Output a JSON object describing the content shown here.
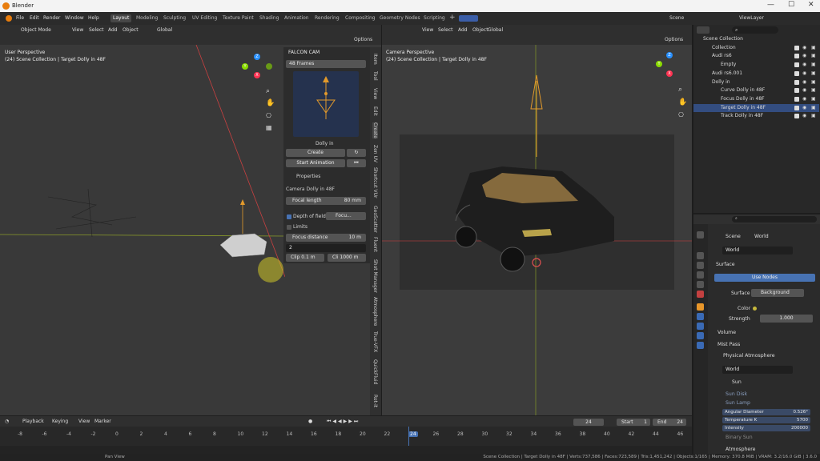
{
  "window": {
    "title": "Blender",
    "minimize": "—",
    "maximize": "☐",
    "close": "✕"
  },
  "menus": [
    "File",
    "Edit",
    "Render",
    "Window",
    "Help"
  ],
  "workspaces": [
    "Layout",
    "Modeling",
    "Sculpting",
    "UV Editing",
    "Texture Paint",
    "Shading",
    "Animation",
    "Rendering",
    "Compositing",
    "Geometry Nodes",
    "Scripting"
  ],
  "active_workspace": "Layout",
  "scene_name": "Scene",
  "view_layer": "ViewLayer",
  "left_viewport": {
    "mode": "Object Mode",
    "menu": [
      "View",
      "Select",
      "Add",
      "Object"
    ],
    "transform": "Global",
    "options": "Options",
    "title": "User Perspective",
    "subtitle": "(24) Scene Collection | Target Dolly in 48F"
  },
  "falcon": {
    "header": "FALCON CAM",
    "frames": "48 Frames",
    "preview_label": "Dolly in",
    "create": "Create",
    "start_animation": "Start Animation",
    "properties": "Properties",
    "camera_name": "Camera Dolly in 48F",
    "focal_length_label": "Focal length",
    "focal_length_value": "80 mm",
    "dof_label": "Depth of field",
    "dof_value": "Focu...",
    "limits": "Limits",
    "focus_distance_label": "Focus distance",
    "focus_distance_value": "10 m",
    "input_value": "2",
    "clip_start": "Clip 0.1 m",
    "clip_end": "Cli 1000 m"
  },
  "vertical_tabs": [
    "Item",
    "Tool",
    "View",
    "Edit",
    "Create",
    "Zen UV",
    "Shortcut VUr",
    "GeoScatter",
    "Fluent",
    "Shot Manager",
    "Atmosphere",
    "True-VFX",
    "QuickFluid",
    "Rot-it"
  ],
  "right_viewport": {
    "menu": [
      "View",
      "Select",
      "Add",
      "Object"
    ],
    "transform": "Global",
    "options": "Options",
    "title": "Camera Perspective",
    "subtitle": "(24) Scene Collection | Target Dolly in 48F"
  },
  "outliner": {
    "search_placeholder": "",
    "rows": [
      {
        "label": "Scene Collection",
        "indent": 0,
        "selected": false
      },
      {
        "label": "Collection",
        "indent": 1,
        "selected": false
      },
      {
        "label": "Audi rs6",
        "indent": 1,
        "selected": false
      },
      {
        "label": "Empty",
        "indent": 2,
        "selected": false
      },
      {
        "label": "Audi rs6.001",
        "indent": 1,
        "selected": false
      },
      {
        "label": "Dolly in",
        "indent": 1,
        "selected": false
      },
      {
        "label": "Curve Dolly in 48F",
        "indent": 2,
        "selected": false
      },
      {
        "label": "Focus Dolly in 48F",
        "indent": 2,
        "selected": false
      },
      {
        "label": "Target Dolly in 48F",
        "indent": 2,
        "selected": true
      },
      {
        "label": "Track Dolly in 48F",
        "indent": 2,
        "selected": false
      }
    ]
  },
  "properties": {
    "breadcrumb_scene": "Scene",
    "breadcrumb_world": "World",
    "world_name": "World",
    "surface": "Surface",
    "use_nodes": "Use Nodes",
    "surface_label": "Surface",
    "surface_value": "Background",
    "color_label": "Color",
    "strength_label": "Strength",
    "strength_value": "1.000",
    "volume": "Volume",
    "mist_pass": "Mist Pass",
    "physical_atmosphere": "Physical Atmosphere",
    "world2": "World",
    "sun": "Sun",
    "sun_disk": "Sun Disk",
    "sun_lamp": "Sun Lamp",
    "angular_diameter_label": "Angular Diameter",
    "angular_diameter_value": "0.526°",
    "temperature_label": "Temperature K",
    "temperature_value": "5700",
    "intensity_label": "Intensity",
    "intensity_value": "200000",
    "binary_sun": "Binary Sun",
    "atmosphere": "Atmosphere"
  },
  "timeline": {
    "menu": [
      "Playback",
      "Keying",
      "View",
      "Marker"
    ],
    "current_frame": "24",
    "start_label": "Start",
    "start": "1",
    "end_label": "End",
    "end": "24",
    "frames": [
      "-8",
      "-6",
      "-4",
      "-2",
      "0",
      "2",
      "4",
      "6",
      "8",
      "10",
      "12",
      "14",
      "16",
      "18",
      "20",
      "22",
      "24",
      "26",
      "28",
      "30",
      "32",
      "34",
      "36",
      "38",
      "40",
      "42",
      "44",
      "46"
    ]
  },
  "status": {
    "action": "Pan View",
    "info": "Scene Collection | Target Dolly in 48F | Verts:737,586 | Faces:723,589 | Tris:1,451,242 | Objects:1/165 | Memory: 370.8 MiB | VRAM: 3.2/16.0 GiB | 3.6.0"
  },
  "colors": {
    "accent": "#4772b3",
    "selection": "#334d80",
    "axis_x": "#ff3352",
    "axis_y": "#8bdc00",
    "axis_z": "#2890ff"
  }
}
